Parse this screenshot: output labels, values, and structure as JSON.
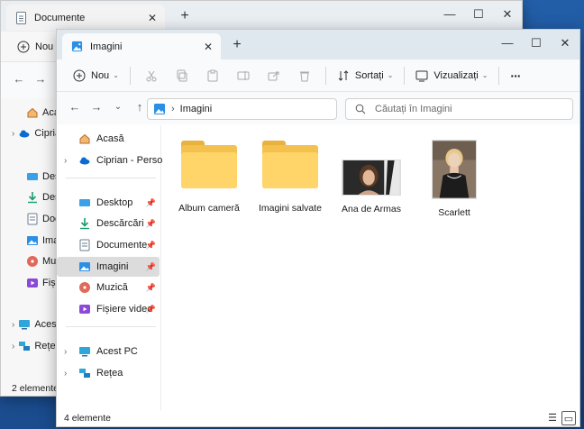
{
  "colors": {
    "accent": "#0067c0",
    "folder": "#ffd56a",
    "selected": "#dcdcdc"
  },
  "back_window": {
    "tab_title": "Documente",
    "new_label": "Nou",
    "sidebar": [
      {
        "label": "Acasă",
        "icon": "home-icon"
      },
      {
        "label": "Ciprian",
        "icon": "cloud-icon"
      },
      {
        "label": "Desktop",
        "icon": "desktop-icon"
      },
      {
        "label": "Descărcări",
        "icon": "download-icon"
      },
      {
        "label": "Documente",
        "icon": "document-icon"
      },
      {
        "label": "Imagini",
        "icon": "image-icon"
      },
      {
        "label": "Muzică",
        "icon": "music-icon"
      },
      {
        "label": "Fișiere",
        "icon": "video-icon"
      },
      {
        "label": "Acest",
        "icon": "pc-icon"
      },
      {
        "label": "Rețea",
        "icon": "network-icon"
      }
    ],
    "status": "2 elemente"
  },
  "front_window": {
    "tab_title": "Imagini",
    "toolbar": {
      "new_label": "Nou",
      "sort_label": "Sortați",
      "view_label": "Vizualizați",
      "more_label": "···"
    },
    "address": {
      "path": "Imagini"
    },
    "search": {
      "placeholder": "Căutați în Imagini"
    },
    "sidebar": {
      "home": "Acasă",
      "cloud": "Ciprian - Personal",
      "desktop": "Desktop",
      "downloads": "Descărcări",
      "documents": "Documente",
      "pictures": "Imagini",
      "music": "Muzică",
      "videos": "Fișiere video",
      "this_pc": "Acest PC",
      "network": "Rețea"
    },
    "items": [
      {
        "label": "Album cameră",
        "type": "folder"
      },
      {
        "label": "Imagini salvate",
        "type": "folder"
      },
      {
        "label": "Ana de Armas",
        "type": "photo"
      },
      {
        "label": "Scarlett",
        "type": "photo"
      }
    ],
    "status": "4 elemente"
  }
}
